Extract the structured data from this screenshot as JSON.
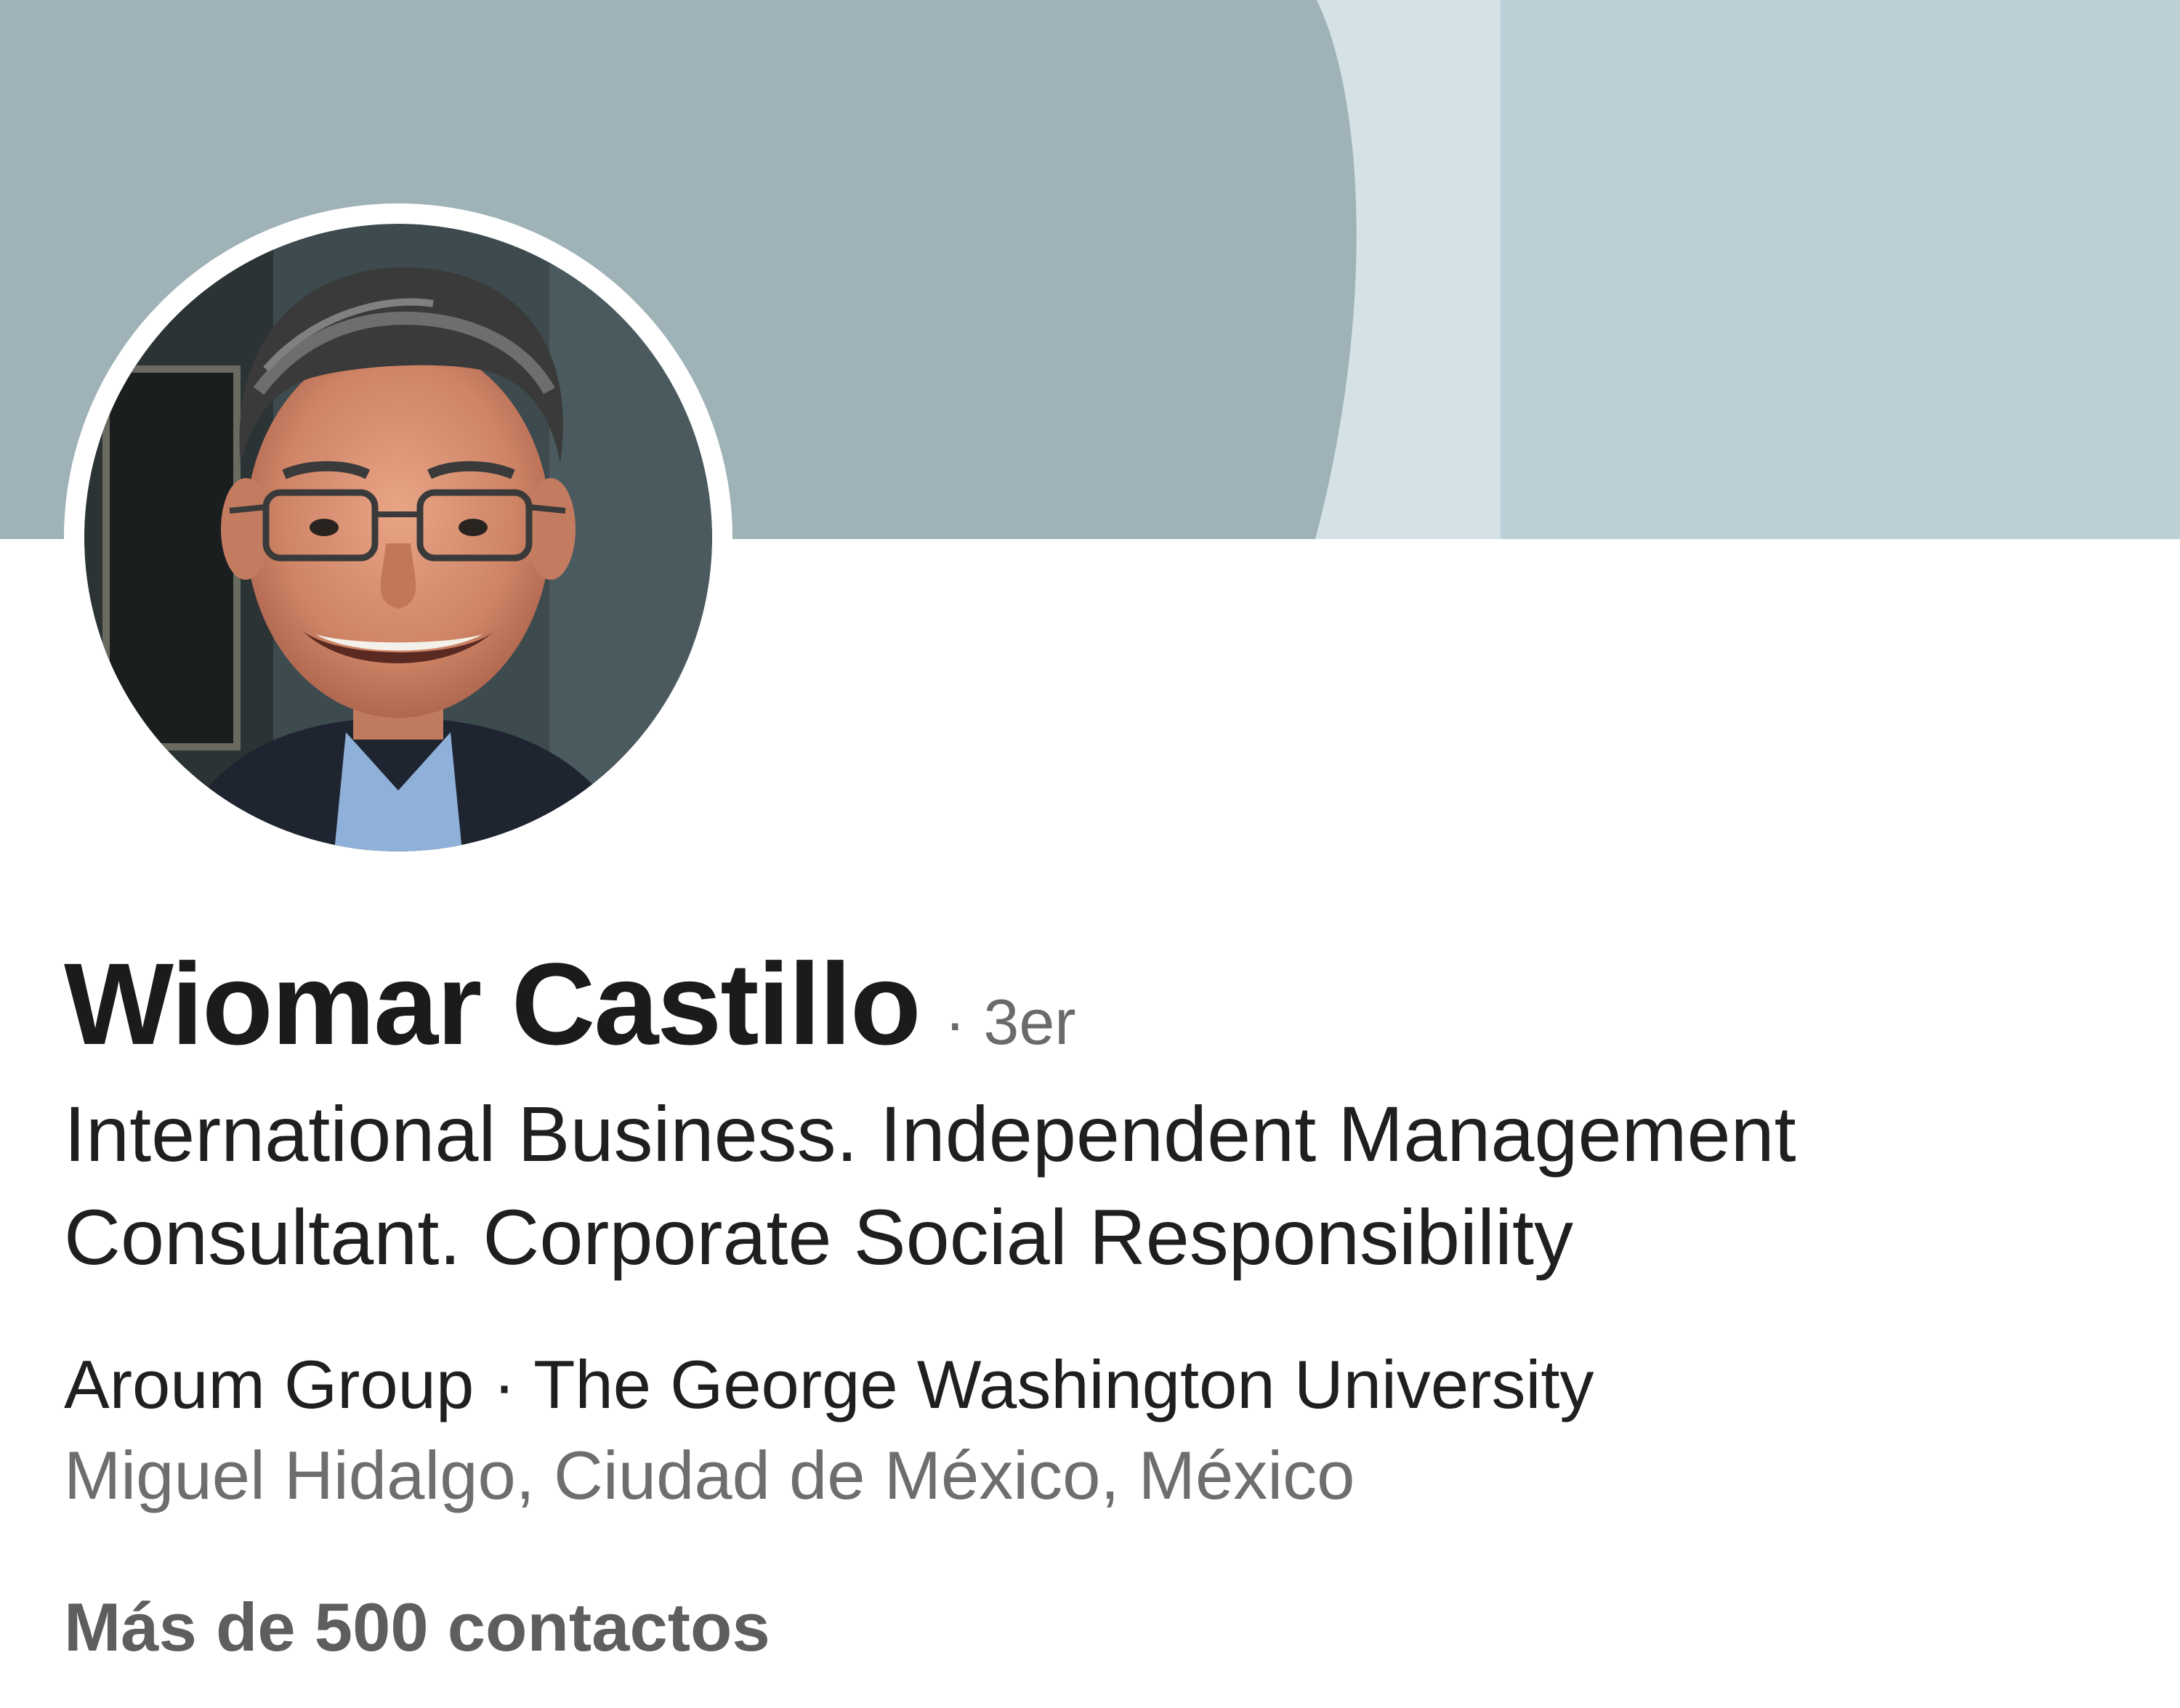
{
  "profile": {
    "name": "Wiomar Castillo",
    "degree": "· 3er",
    "headline_line1": "International Business. Independent Management",
    "headline_line2": "Consultant. Corporate Social Responsibility",
    "organizations": "Aroum Group · The George Washington University",
    "location": "Miguel Hidalgo, Ciudad de México, México",
    "connections": "Más de 500 contactos"
  },
  "colors": {
    "banner_dark": "#9eb2b8",
    "banner_mid": "#d4e2e6",
    "banner_light": "#bccfd6",
    "text_primary": "#1b1b1b",
    "text_secondary": "#6e6e6e"
  }
}
